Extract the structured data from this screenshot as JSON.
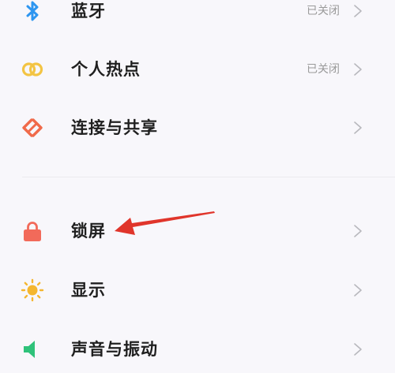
{
  "settings": {
    "group1": [
      {
        "key": "bluetooth",
        "label": "蓝牙",
        "status": "已关闭",
        "icon": "bluetooth-icon",
        "color": "#2e96f0"
      },
      {
        "key": "hotspot",
        "label": "个人热点",
        "status": "已关闭",
        "icon": "hotspot-icon",
        "color": "#f3c443"
      },
      {
        "key": "connection-sharing",
        "label": "连接与共享",
        "status": "",
        "icon": "connection-share-icon",
        "color": "#f06a4a"
      }
    ],
    "group2": [
      {
        "key": "lock-screen",
        "label": "锁屏",
        "status": "",
        "icon": "lock-icon",
        "color": "#f26a5a"
      },
      {
        "key": "display",
        "label": "显示",
        "status": "",
        "icon": "sun-icon",
        "color": "#f4b62f"
      },
      {
        "key": "sound-vibration",
        "label": "声音与振动",
        "status": "",
        "icon": "sound-icon",
        "color": "#2fc27a"
      }
    ]
  },
  "annotation": {
    "arrow_color": "#e0352b"
  }
}
